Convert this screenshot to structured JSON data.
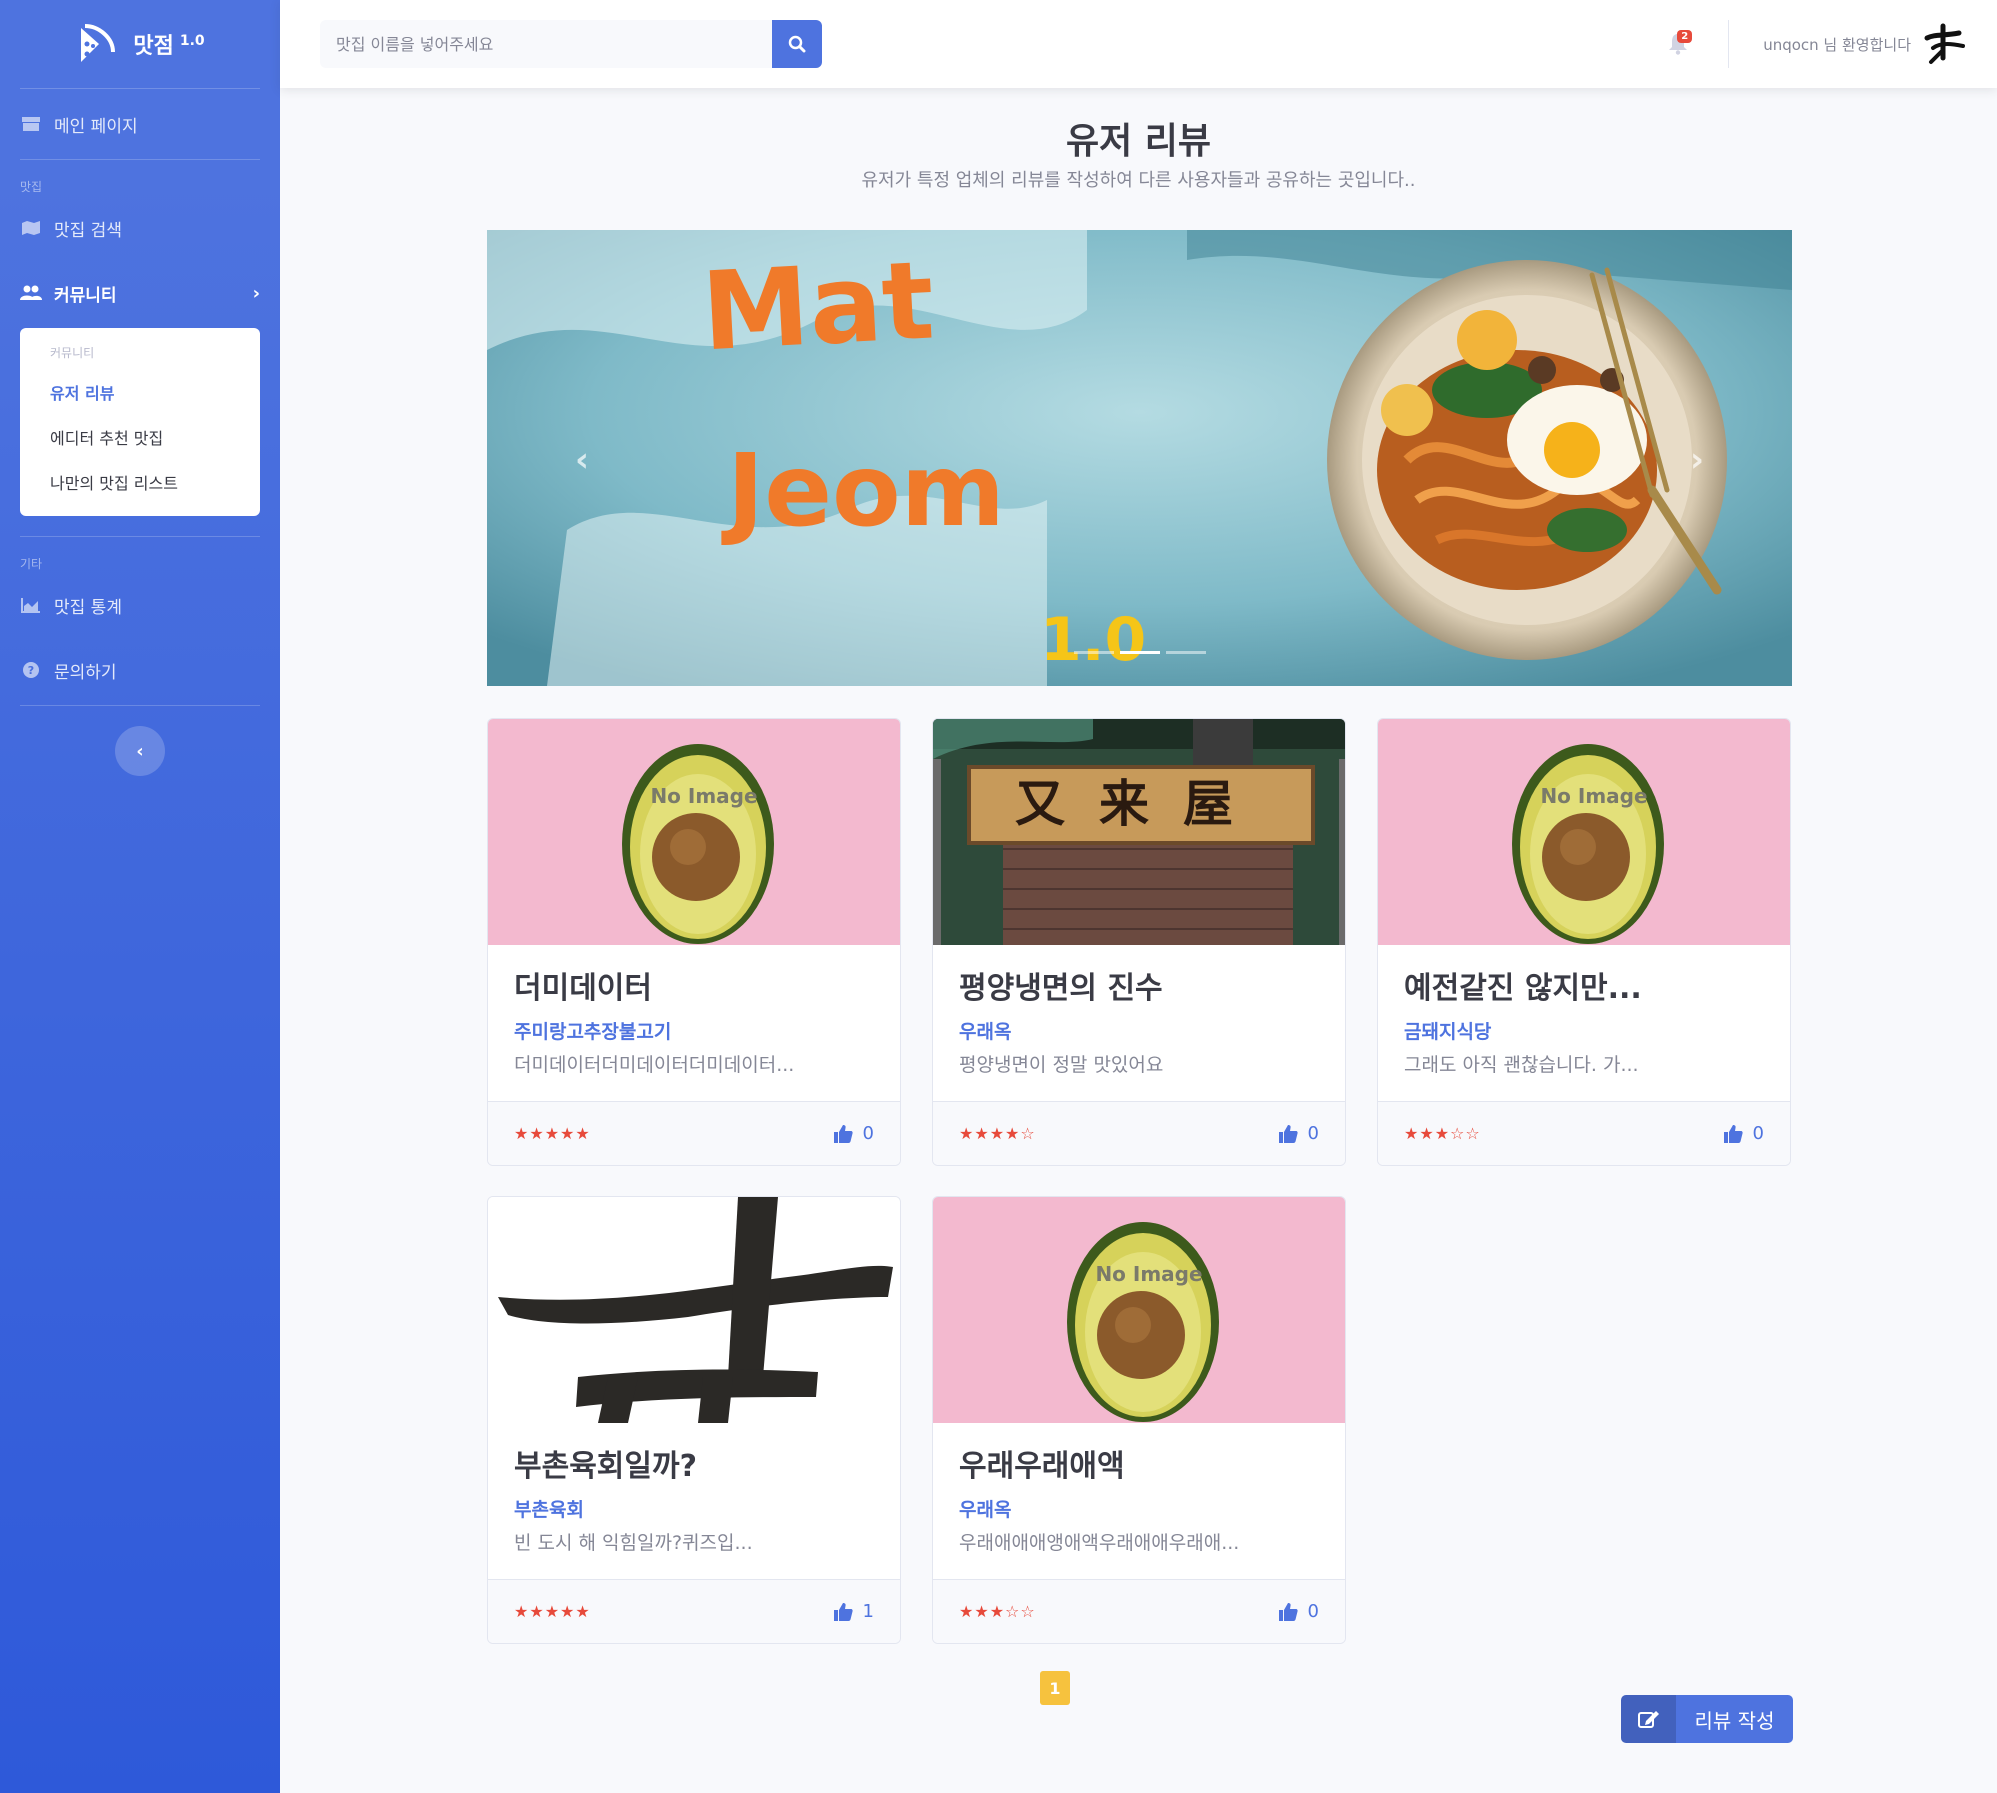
{
  "brand": {
    "name": "맛점",
    "version": "1.0"
  },
  "sidebar": {
    "main": "메인 페이지",
    "heading_food": "맛집",
    "search": "맛집 검색",
    "community": "커뮤니티",
    "collapse_header": "커뮤니티",
    "collapse_items": [
      "유저 리뷰",
      "에디터 추천 맛집",
      "나만의 맛집 리스트"
    ],
    "heading_etc": "기타",
    "stats": "맛집 통계",
    "inquiry": "문의하기"
  },
  "topbar": {
    "search_placeholder": "맛집 이름을 넣어주세요",
    "alert_count": "2",
    "user_greeting": "unqocn 님 환영합니다"
  },
  "page": {
    "title": "유저 리뷰",
    "subtitle": "유저가 특정 업체의 리뷰를 작성하여 다른 사용자들과 공유하는 곳입니다.."
  },
  "carousel": {
    "line1": "Mat",
    "line2": "Jeom",
    "line3": "1.0",
    "indicators": 3,
    "active_index": 1
  },
  "reviews": [
    {
      "title": "더미데이터",
      "place": "주미랑고추장불고기",
      "text": "더미데이터더미데이터더미데이터...",
      "stars": "★★★★★",
      "rating": 5,
      "likes": "0",
      "image": "no-image"
    },
    {
      "title": "평양냉면의 진수",
      "place": "우래옥",
      "text": "평양냉면이 정말 맛있어요",
      "stars": "★★★★☆",
      "rating": 4,
      "likes": "0",
      "image": "storefront"
    },
    {
      "title": "예전같진 않지만...",
      "place": "금돼지식당",
      "text": "그래도 아직 괜찮습니다. 가...",
      "stars": "★★★☆☆",
      "rating": 3,
      "likes": "0",
      "image": "no-image"
    },
    {
      "title": "부촌육회일까?",
      "place": "부촌육회",
      "text": "빈 도시 해 익힘일까?퀴즈입...",
      "stars": "★★★★★",
      "rating": 5,
      "likes": "1",
      "image": "calligraphy"
    },
    {
      "title": "우래우래애액",
      "place": "우래옥",
      "text": "우래애애애앵애액우래애애우래애...",
      "stars": "★★★☆☆",
      "rating": 3,
      "likes": "0",
      "image": "no-image"
    }
  ],
  "no_image_text": "No Image",
  "storefront_sign": "又来屋",
  "pagination": {
    "current": "1"
  },
  "write_button": "리뷰 작성",
  "colors": {
    "primary": "#4e73df",
    "star": "#e74a3b",
    "page_active": "#f6c23e",
    "carousel_text": "#f07a2a"
  }
}
